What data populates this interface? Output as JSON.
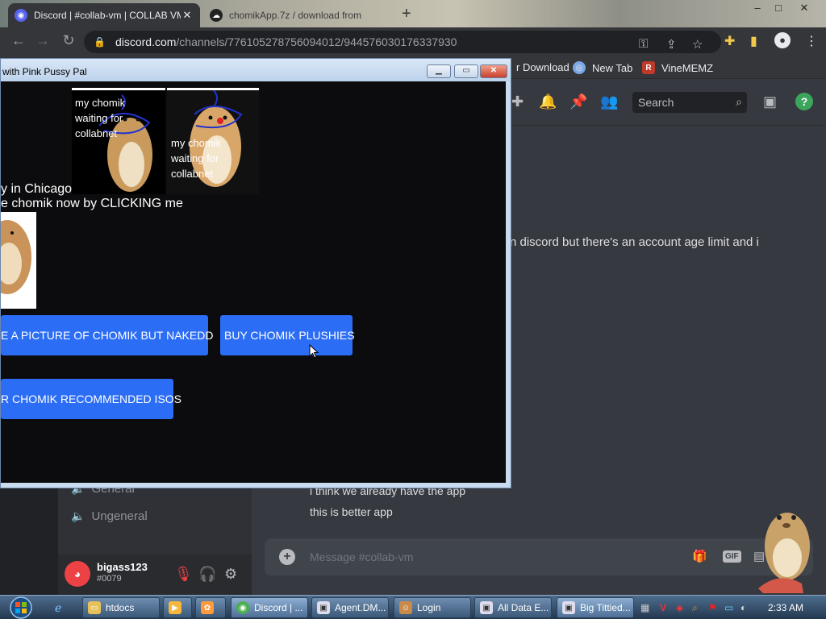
{
  "browser": {
    "tabs": [
      {
        "title": "Discord | #collab-vm | COLLAB VM",
        "icon": "discord-icon"
      },
      {
        "title": "chomikApp.7z / download from",
        "icon": "cloud-icon"
      }
    ],
    "new_tab": "+",
    "window_controls": [
      "–",
      "□",
      "✕"
    ],
    "url_host": "discord.com",
    "url_path": "/channels/776105278756094012/944576030176337930",
    "bookmarks": [
      {
        "label": "r Download",
        "icon_color": "#d33"
      },
      {
        "label": "New Tab",
        "icon_color": "#7aa7e6"
      },
      {
        "label": "VineMEMZ",
        "icon_color": "#c0392b"
      }
    ]
  },
  "discord": {
    "search_placeholder": "Search",
    "channels": [
      {
        "label": "General"
      },
      {
        "label": "Ungeneral"
      }
    ],
    "user": {
      "name": "bigass123",
      "tag": "#0079"
    },
    "messages": [
      "n discord but there's an account age limit and i",
      "i think we already have the app",
      "this is better app"
    ],
    "input_placeholder": "Message #collab-vm",
    "accent": "#5865f2"
  },
  "popup": {
    "title": "with Pink Pussy Pal",
    "memes": [
      {
        "caption_lines": [
          "my chomik",
          "waiting for",
          "collabnet"
        ]
      },
      {
        "caption_lines": [
          "my chomik",
          "waiting for",
          "collabnet"
        ]
      }
    ],
    "lines": [
      "y in Chicago",
      "e chomik now by CLICKING me"
    ],
    "buttons": [
      "E A PICTURE OF CHOMIK BUT NAKEDD",
      "BUY CHOMIK PLUSHIES",
      "R CHOMIK RECOMMENDED ISOS"
    ],
    "button_color": "#2c6df5"
  },
  "taskbar": {
    "items": [
      {
        "label": "htdocs",
        "icon_color": "#e6c15a"
      },
      {
        "label": "",
        "icon_color": "#f5b83d"
      },
      {
        "label": "",
        "icon_color": "#ff9a3c"
      },
      {
        "label": "Discord | ...",
        "icon_color": "#4caf50"
      },
      {
        "label": "Agent.DM...",
        "icon_color": "#dde"
      },
      {
        "label": "Login",
        "icon_color": "#c98b4a"
      },
      {
        "label": "All Data E...",
        "icon_color": "#dde"
      },
      {
        "label": "Big Tittied...",
        "icon_color": "#dde"
      }
    ],
    "clock": "2:33 AM"
  }
}
